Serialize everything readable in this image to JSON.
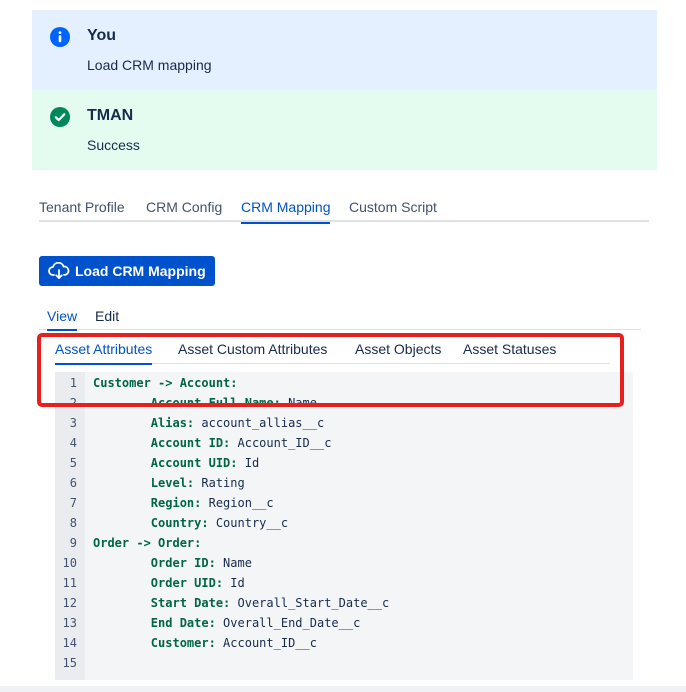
{
  "messages": {
    "you": {
      "sender": "You",
      "text": "Load CRM mapping",
      "icon": "info-icon",
      "icon_color": "#0065ff",
      "background": "#e4efff"
    },
    "tman": {
      "sender": "TMAN",
      "text": "Success",
      "icon": "check-circle-icon",
      "icon_color": "#00875a",
      "background": "#e3fcef"
    }
  },
  "main_tabs": [
    {
      "label": "Tenant Profile",
      "active": false
    },
    {
      "label": "CRM Config",
      "active": false
    },
    {
      "label": "CRM Mapping",
      "active": true
    },
    {
      "label": "Custom Script",
      "active": false
    }
  ],
  "load_button": {
    "label": "Load CRM Mapping",
    "icon": "cloud-download-icon",
    "color": "#0052cc"
  },
  "view_edit_tabs": [
    {
      "label": "View",
      "active": true
    },
    {
      "label": "Edit",
      "active": false
    }
  ],
  "sub_tabs": [
    {
      "label": "Asset Attributes",
      "active": true
    },
    {
      "label": "Asset Custom Attributes",
      "active": false
    },
    {
      "label": "Asset Objects",
      "active": false
    },
    {
      "label": "Asset Statuses",
      "active": false
    }
  ],
  "highlight_color": "#e8201d",
  "code": {
    "lines": [
      {
        "num": "1",
        "key": "Customer -> Account:",
        "value": "",
        "indent": false
      },
      {
        "num": "2",
        "key": "Account Full Name:",
        "value": " Name",
        "indent": true
      },
      {
        "num": "3",
        "key": "Alias:",
        "value": " account_allias__c",
        "indent": true
      },
      {
        "num": "4",
        "key": "Account ID:",
        "value": " Account_ID__c",
        "indent": true
      },
      {
        "num": "5",
        "key": "Account UID:",
        "value": " Id",
        "indent": true
      },
      {
        "num": "6",
        "key": "Level:",
        "value": " Rating",
        "indent": true
      },
      {
        "num": "7",
        "key": "Region:",
        "value": " Region__c",
        "indent": true
      },
      {
        "num": "8",
        "key": "Country:",
        "value": " Country__c",
        "indent": true
      },
      {
        "num": "9",
        "key": "Order -> Order:",
        "value": "",
        "indent": false
      },
      {
        "num": "10",
        "key": "Order ID:",
        "value": " Name",
        "indent": true
      },
      {
        "num": "11",
        "key": "Order UID:",
        "value": " Id",
        "indent": true
      },
      {
        "num": "12",
        "key": "Start Date:",
        "value": " Overall_Start_Date__c",
        "indent": true
      },
      {
        "num": "13",
        "key": "End Date:",
        "value": " Overall_End_Date__c",
        "indent": true
      },
      {
        "num": "14",
        "key": "Customer:",
        "value": " Account_ID__c",
        "indent": true
      },
      {
        "num": "15",
        "key": "",
        "value": "",
        "indent": false
      }
    ]
  }
}
